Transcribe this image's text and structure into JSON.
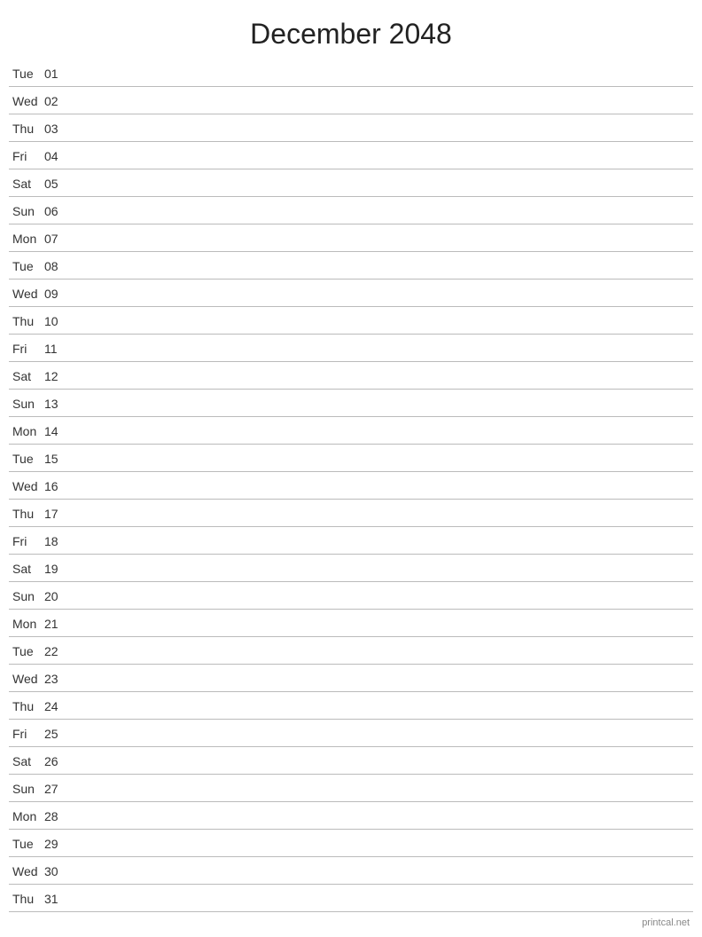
{
  "title": "December 2048",
  "days": [
    {
      "name": "Tue",
      "number": "01"
    },
    {
      "name": "Wed",
      "number": "02"
    },
    {
      "name": "Thu",
      "number": "03"
    },
    {
      "name": "Fri",
      "number": "04"
    },
    {
      "name": "Sat",
      "number": "05"
    },
    {
      "name": "Sun",
      "number": "06"
    },
    {
      "name": "Mon",
      "number": "07"
    },
    {
      "name": "Tue",
      "number": "08"
    },
    {
      "name": "Wed",
      "number": "09"
    },
    {
      "name": "Thu",
      "number": "10"
    },
    {
      "name": "Fri",
      "number": "11"
    },
    {
      "name": "Sat",
      "number": "12"
    },
    {
      "name": "Sun",
      "number": "13"
    },
    {
      "name": "Mon",
      "number": "14"
    },
    {
      "name": "Tue",
      "number": "15"
    },
    {
      "name": "Wed",
      "number": "16"
    },
    {
      "name": "Thu",
      "number": "17"
    },
    {
      "name": "Fri",
      "number": "18"
    },
    {
      "name": "Sat",
      "number": "19"
    },
    {
      "name": "Sun",
      "number": "20"
    },
    {
      "name": "Mon",
      "number": "21"
    },
    {
      "name": "Tue",
      "number": "22"
    },
    {
      "name": "Wed",
      "number": "23"
    },
    {
      "name": "Thu",
      "number": "24"
    },
    {
      "name": "Fri",
      "number": "25"
    },
    {
      "name": "Sat",
      "number": "26"
    },
    {
      "name": "Sun",
      "number": "27"
    },
    {
      "name": "Mon",
      "number": "28"
    },
    {
      "name": "Tue",
      "number": "29"
    },
    {
      "name": "Wed",
      "number": "30"
    },
    {
      "name": "Thu",
      "number": "31"
    }
  ],
  "footer": "printcal.net"
}
